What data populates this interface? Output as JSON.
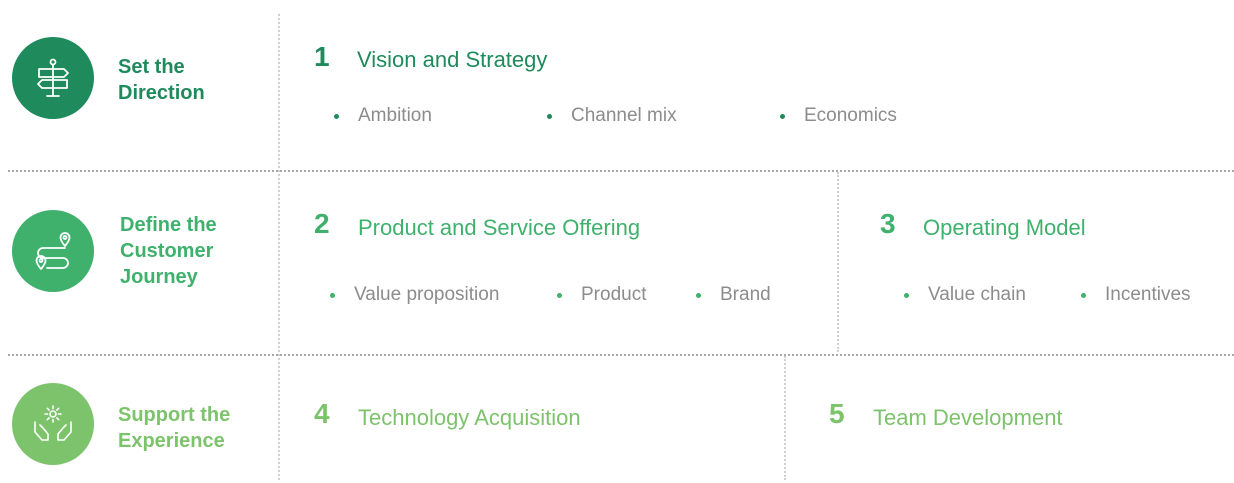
{
  "colors": {
    "dark_green": "#1f8a5b",
    "mid_green": "#3fb16d",
    "light_green": "#7cc36b",
    "bullet_text": "#8c8c8c"
  },
  "rows": [
    {
      "icon": "signpost-icon",
      "label": [
        "Set the",
        "Direction"
      ],
      "sections": [
        {
          "number": "1",
          "title": "Vision and Strategy",
          "bullets": [
            "Ambition",
            "Channel mix",
            "Economics"
          ]
        }
      ]
    },
    {
      "icon": "route-pins-icon",
      "label": [
        "Define the",
        "Customer",
        "Journey"
      ],
      "sections": [
        {
          "number": "2",
          "title": "Product and Service Offering",
          "bullets": [
            "Value proposition",
            "Product",
            "Brand"
          ]
        },
        {
          "number": "3",
          "title": "Operating Model",
          "bullets": [
            "Value chain",
            "Incentives"
          ]
        }
      ]
    },
    {
      "icon": "hands-gear-icon",
      "label": [
        "Support the",
        "Experience"
      ],
      "sections": [
        {
          "number": "4",
          "title": "Technology Acquisition",
          "bullets": []
        },
        {
          "number": "5",
          "title": "Team Development",
          "bullets": []
        }
      ]
    }
  ]
}
